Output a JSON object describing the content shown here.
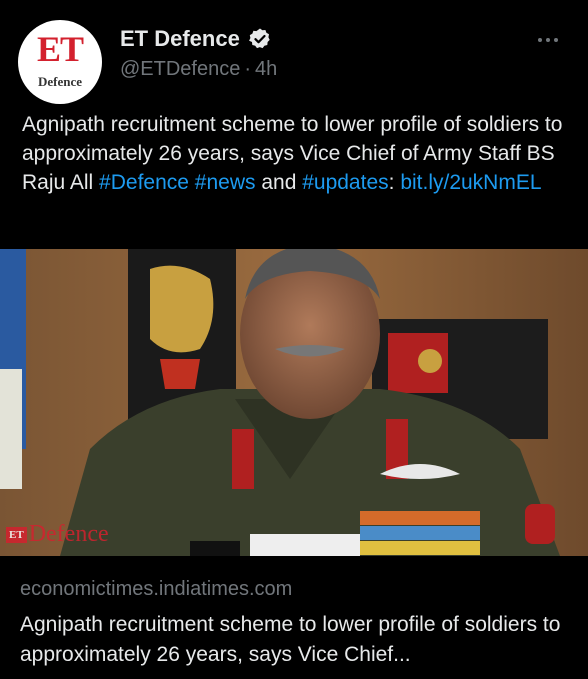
{
  "author": {
    "avatar_text": "ET",
    "avatar_subtext": "Defence",
    "display_name": "ET Defence",
    "handle": "@ETDefence",
    "separator": "·",
    "time": "4h"
  },
  "tweet": {
    "text_plain": "Agnipath recruitment scheme to lower profile of soldiers to approximately 26 years, says Vice Chief of Army Staff BS Raju All ",
    "hashtag1": "#Defence",
    "space1": " ",
    "hashtag2": "#news",
    "and_text": " and ",
    "hashtag3": "#updates",
    "colon": ": ",
    "url": "bit.ly/2ukNmEL"
  },
  "media": {
    "watermark_box": "ET",
    "watermark_text": "Defence"
  },
  "card": {
    "domain": "economictimes.indiatimes.com",
    "title": "Agnipath recruitment scheme to lower profile of soldiers to approximately 26 years, says Vice Chief..."
  },
  "colors": {
    "background": "#000000",
    "text": "#e7e9ea",
    "secondary": "#71767b",
    "link": "#1d9bf0",
    "brand_red": "#d3212e"
  },
  "icons": [
    "verified-badge-icon",
    "more-options-icon"
  ]
}
